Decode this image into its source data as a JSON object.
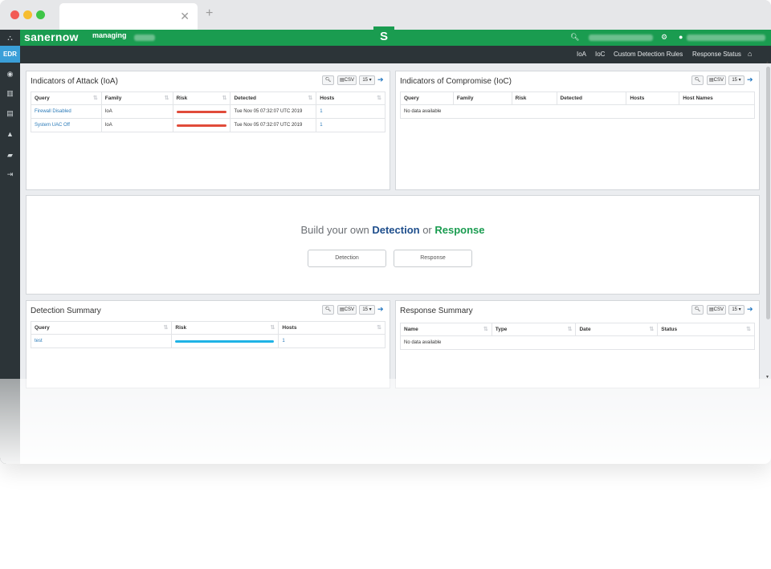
{
  "topbar": {
    "logo": "sanernow",
    "managing_label": "managing",
    "badge_letter": "S"
  },
  "sidebar": {
    "edr_label": "EDR",
    "icons": [
      "sitemap-icon",
      "eye-icon",
      "chart-icon",
      "list-icon",
      "warning-icon",
      "book-icon",
      "logout-icon"
    ]
  },
  "subnav": {
    "ioa": "IoA",
    "ioc": "IoC",
    "custom": "Custom Detection Rules",
    "response": "Response Status"
  },
  "toolbar": {
    "csv": "CSV",
    "page_size": "15 ▾"
  },
  "ioa_panel": {
    "title": "Indicators of Attack (IoA)",
    "headers": [
      "Query",
      "Family",
      "Risk",
      "Detected",
      "Hosts"
    ],
    "rows": [
      {
        "query": "Firewall Disabled",
        "family": "IoA",
        "risk": 1.0,
        "detected": "Tue Nov 05 07:32:07 UTC 2019",
        "hosts": "1"
      },
      {
        "query": "System UAC Off",
        "family": "IoA",
        "risk": 1.0,
        "detected": "Tue Nov 05 07:32:07 UTC 2019",
        "hosts": "1"
      }
    ],
    "risk_color": "#e04b3a"
  },
  "ioc_panel": {
    "title": "Indicators of Compromise (IoC)",
    "headers": [
      "Query",
      "Family",
      "Risk",
      "Detected",
      "Hosts",
      "Host Names"
    ],
    "empty": "No data available"
  },
  "build_panel": {
    "prefix": "Build your own ",
    "detection": "Detection",
    "or": " or ",
    "response": "Response",
    "detection_button": "Detection",
    "response_button": "Response"
  },
  "detection_summary": {
    "title": "Detection Summary",
    "headers": [
      "Query",
      "Risk",
      "Hosts"
    ],
    "rows": [
      {
        "query": "test",
        "risk": 1.0,
        "hosts": "1"
      }
    ],
    "risk_color": "#1fb3e6"
  },
  "response_summary": {
    "title": "Response Summary",
    "headers": [
      "Name",
      "Type",
      "Date",
      "Status"
    ],
    "empty": "No data available"
  },
  "colors": {
    "brand_green": "#1a9c50",
    "dark_nav": "#2c3438",
    "edr_blue": "#3a9fd8"
  }
}
